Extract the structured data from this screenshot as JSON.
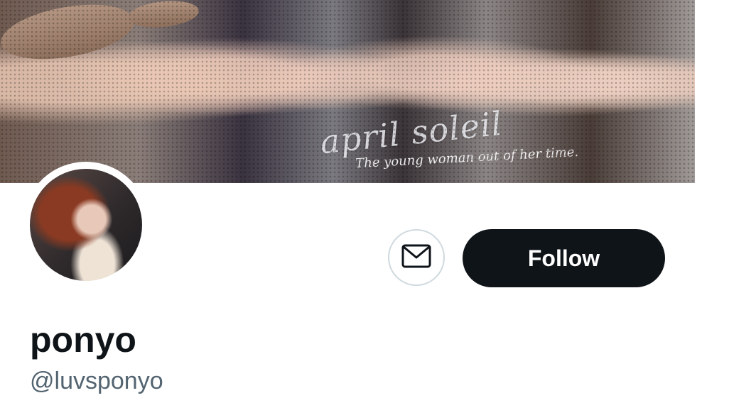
{
  "banner": {
    "script_title": "april soleil",
    "tagline": "The young woman out of her time."
  },
  "profile": {
    "display_name": "ponyo",
    "handle": "@luvsponyo"
  },
  "actions": {
    "message_icon": "mail-icon",
    "follow_label": "Follow"
  },
  "colors": {
    "follow_bg": "#0f1419",
    "handle_text": "#536471",
    "border": "#cfd9de"
  }
}
